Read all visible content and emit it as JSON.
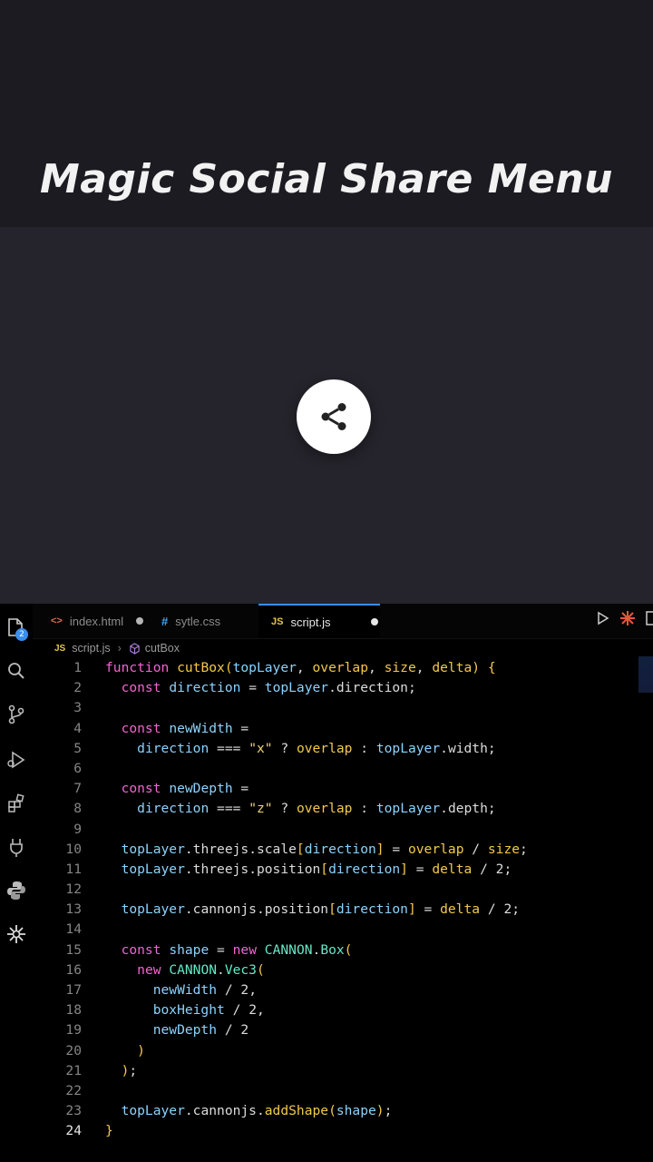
{
  "preview": {
    "title": "Magic Social Share Menu",
    "share_icon": "share-icon"
  },
  "editor": {
    "tabs": [
      {
        "icon": "<>",
        "label": "index.html",
        "modified": true,
        "active": false
      },
      {
        "icon": "#",
        "label": "sytle.css",
        "modified": false,
        "active": false
      },
      {
        "icon": "JS",
        "label": "script.js",
        "modified": true,
        "active": true
      }
    ],
    "breadcrumb": {
      "file_icon": "JS",
      "file": "script.js",
      "symbol": "cutBox"
    },
    "activity_icons": [
      "files-icon",
      "search-icon",
      "source-control-icon",
      "run-debug-icon",
      "extensions-icon",
      "plug-icon",
      "python-icon",
      "gear-splash-icon"
    ],
    "activity_badge": "2",
    "current_line": 24,
    "code_lines": [
      "function cutBox(topLayer, overlap, size, delta) {",
      "  const direction = topLayer.direction;",
      "",
      "  const newWidth =",
      "    direction === \"x\" ? overlap : topLayer.width;",
      "",
      "  const newDepth =",
      "    direction === \"z\" ? overlap : topLayer.depth;",
      "",
      "  topLayer.threejs.scale[direction] = overlap / size;",
      "  topLayer.threejs.position[direction] = delta / 2;",
      "",
      "  topLayer.cannonjs.position[direction] = delta / 2;",
      "",
      "  const shape = new CANNON.Box(",
      "    new CANNON.Vec3(",
      "      newWidth / 2,",
      "      boxHeight / 2,",
      "      newDepth / 2",
      "    )",
      "  );",
      "",
      "  topLayer.cannonjs.addShape(shape);",
      "}"
    ]
  }
}
